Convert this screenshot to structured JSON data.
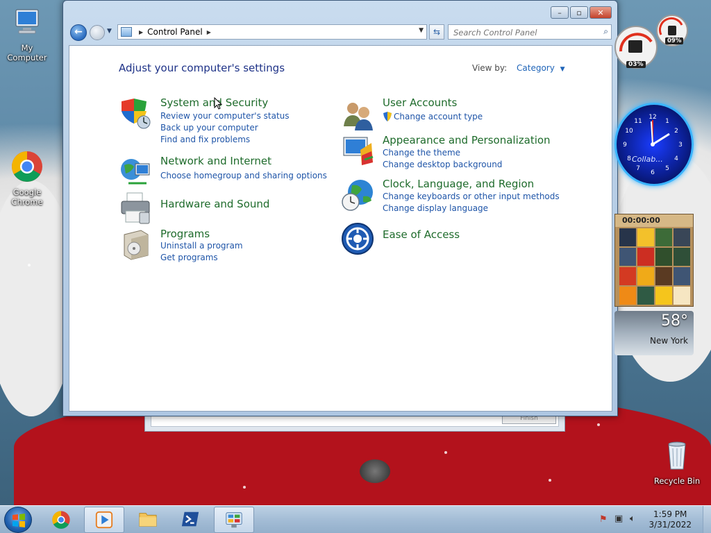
{
  "desktop": {
    "icons": [
      {
        "label": "My Computer"
      },
      {
        "label": "Google Chrome"
      },
      {
        "label": "Recycle Bin"
      }
    ]
  },
  "window": {
    "controls": {
      "minimize": "–",
      "maximize": "▫",
      "close": "✕"
    },
    "address": {
      "location": "Control Panel"
    },
    "search": {
      "placeholder": "Search Control Panel"
    },
    "heading": "Adjust your computer's settings",
    "view_by": {
      "label": "View by:",
      "value": "Category"
    },
    "categories_left": [
      {
        "title": "System and Security",
        "links": [
          "Review your computer's status",
          "Back up your computer",
          "Find and fix problems"
        ]
      },
      {
        "title": "Network and Internet",
        "links": [
          "Choose homegroup and sharing options"
        ]
      },
      {
        "title": "Hardware and Sound",
        "links": []
      },
      {
        "title": "Programs",
        "links": [
          "Uninstall a program",
          "Get programs"
        ]
      }
    ],
    "categories_right": [
      {
        "title": "User Accounts",
        "links": [
          "Change account type"
        ]
      },
      {
        "title": "Appearance and Personalization",
        "links": [
          "Change the theme",
          "Change desktop background"
        ]
      },
      {
        "title": "Clock, Language, and Region",
        "links": [
          "Change keyboards or other input methods",
          "Change display language"
        ]
      },
      {
        "title": "Ease of Access",
        "links": []
      }
    ]
  },
  "background_window": {
    "finish_label": "Finish"
  },
  "gadgets": {
    "cpu_meter": {
      "cpu": "03%",
      "memory": "09%"
    },
    "clock_label": "Collab...",
    "puzzle_timer": "00:00:00",
    "weather": {
      "temperature": "58°",
      "city": "New York"
    }
  },
  "taskbar": {
    "time": "1:59 PM",
    "date": "3/31/2022"
  }
}
